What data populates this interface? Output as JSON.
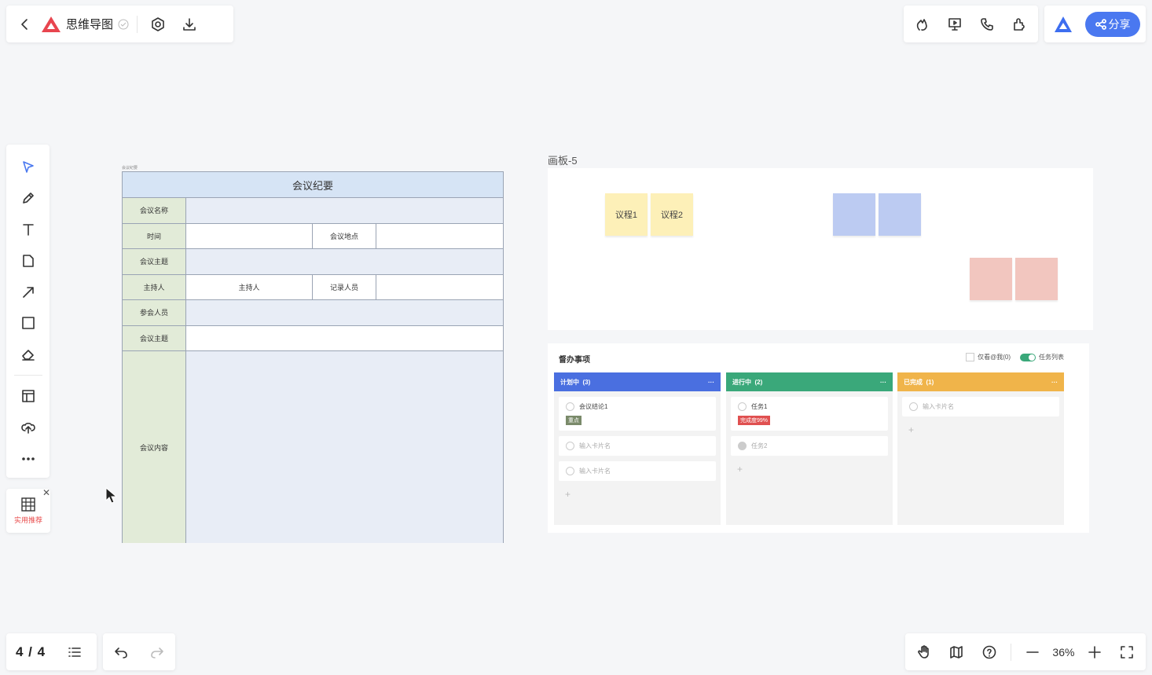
{
  "header": {
    "title": "思维导图",
    "share_label": "分享"
  },
  "left_toolbar": {
    "tools": [
      "select-icon",
      "pen-icon",
      "text-icon",
      "sticky-note-icon",
      "arrow-icon",
      "rectangle-icon",
      "eraser-icon",
      "template-icon",
      "upload-icon",
      "more-icon"
    ],
    "recommend_label": "实用推荐"
  },
  "minutes": {
    "caption": "会议纪要",
    "title": "会议纪要",
    "rows": {
      "name_label": "会议名称",
      "time_label": "时间",
      "location_label": "会议地点",
      "topic_label": "会议主题",
      "host_label": "主持人",
      "host_value": "主持人",
      "recorder_label": "记录人员",
      "attendees_label": "参会人员",
      "topic2_label": "会议主题",
      "content_label": "会议内容"
    }
  },
  "board": {
    "title": "画板-5",
    "stickies": [
      {
        "text": "议程1",
        "color": "#fdf0b8"
      },
      {
        "text": "议程2",
        "color": "#fdf0b8"
      },
      {
        "text": "",
        "color": "#bccbf2"
      },
      {
        "text": "",
        "color": "#bccbf2"
      },
      {
        "text": "",
        "color": "#f2c6bf"
      },
      {
        "text": "",
        "color": "#f2c6bf"
      }
    ]
  },
  "kanban": {
    "title": "督办事项",
    "filter_label": "仅看@我(0)",
    "toggle_label": "任务列表",
    "columns": [
      {
        "title": "计划中",
        "count": "(3)",
        "color": "#4a6fe0",
        "cards": [
          {
            "text": "会议结论1",
            "tag": "重点",
            "tag_color": "#7a8a6a"
          },
          {
            "text": "输入卡片名"
          },
          {
            "text": "输入卡片名"
          }
        ]
      },
      {
        "title": "进行中",
        "count": "(2)",
        "color": "#3aa87a",
        "cards": [
          {
            "text": "任务1",
            "tag": "完成度99%",
            "tag_color": "#e05050"
          },
          {
            "text": "任务2",
            "done": true
          }
        ]
      },
      {
        "title": "已完成",
        "count": "(1)",
        "color": "#f0b44a",
        "cards": [
          {
            "text": "输入卡片名"
          }
        ]
      }
    ],
    "more_label": "···",
    "plus_label": "+"
  },
  "footer": {
    "page": "4 / 4",
    "zoom": "36%"
  }
}
